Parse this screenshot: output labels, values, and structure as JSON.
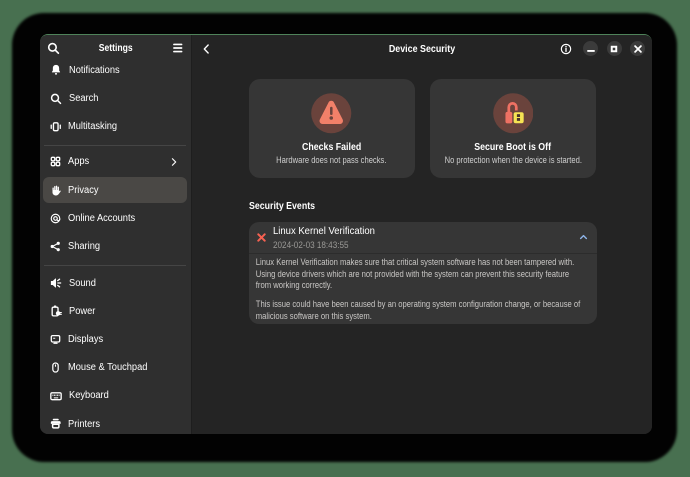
{
  "desktop": {
    "background_color": "#487050"
  },
  "sidebar": {
    "title": "Settings",
    "items": [
      {
        "label": "Notifications",
        "icon": "bell-icon"
      },
      {
        "label": "Search",
        "icon": "search-icon"
      },
      {
        "label": "Multitasking",
        "icon": "multitasking-icon"
      },
      {
        "label": "Apps",
        "icon": "apps-grid-icon",
        "has_chevron": true
      },
      {
        "label": "Privacy",
        "icon": "hand-icon",
        "selected": true
      },
      {
        "label": "Online Accounts",
        "icon": "at-icon"
      },
      {
        "label": "Sharing",
        "icon": "share-icon"
      },
      {
        "label": "Sound",
        "icon": "speaker-icon"
      },
      {
        "label": "Power",
        "icon": "battery-icon"
      },
      {
        "label": "Displays",
        "icon": "display-icon"
      },
      {
        "label": "Mouse & Touchpad",
        "icon": "mouse-icon"
      },
      {
        "label": "Keyboard",
        "icon": "keyboard-icon"
      },
      {
        "label": "Printers",
        "icon": "printer-icon"
      }
    ]
  },
  "header": {
    "title": "Device Security",
    "window_controls": [
      "minimize",
      "maximize",
      "close"
    ]
  },
  "cards": [
    {
      "title": "Checks Failed",
      "subtitle": "Hardware does not pass checks.",
      "icon": "warning-triangle-icon",
      "icon_color": "#f28069",
      "icon_circle_color": "#6a433c"
    },
    {
      "title": "Secure Boot is Off",
      "subtitle": "No protection when the device is started.",
      "icon": "unlocked-padlock-icon",
      "lock_red": "#ee7163",
      "lock_yellow": "#f6e353",
      "icon_circle_color": "#6a433c"
    }
  ],
  "events": {
    "section_title": "Security Events",
    "rows": [
      {
        "title": "Linux Kernel Verification",
        "timestamp": "2024-02-03 18:43:55",
        "status_icon": "failed-x-icon",
        "expanded": true,
        "chevron_color": "#8fb5ea",
        "description_paragraphs": [
          "Linux Kernel Verification makes sure that critical system software has not been tampered with. Using device drivers which are not provided with the system can prevent this security feature from working correctly.",
          "This issue could have been caused by an operating system configuration change, or because of malicious software on this system."
        ]
      }
    ]
  }
}
